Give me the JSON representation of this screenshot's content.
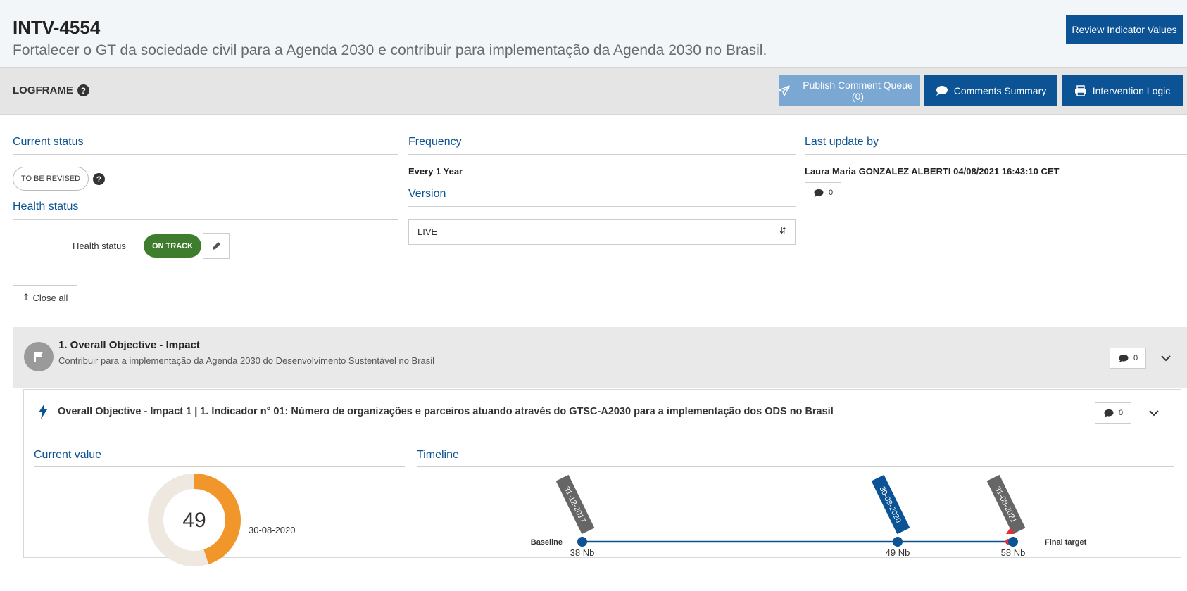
{
  "header": {
    "code": "INTV-4554",
    "subtitle": "Fortalecer o GT da sociedade civil para a Agenda 2030 e contribuir para implementação da Agenda 2030 no Brasil.",
    "review_button": "Review Indicator Values"
  },
  "logframe": {
    "title": "LOGFRAME",
    "publish_button": "Publish Comment Queue (0)",
    "comments_summary_button": "Comments Summary",
    "intervention_logic_button": "Intervention Logic"
  },
  "status": {
    "current_status_label": "Current status",
    "current_status_value": "TO BE REVISED",
    "health_status_heading": "Health status",
    "health_status_label": "Health status",
    "health_status_value": "ON TRACK"
  },
  "frequency": {
    "label": "Frequency",
    "value": "Every 1 Year",
    "version_label": "Version",
    "version_selected": "LIVE"
  },
  "last_update": {
    "label": "Last update by",
    "value": "Laura Maria GONZALEZ ALBERTI 04/08/2021 16:43:10 CET",
    "comment_count": "0"
  },
  "close_all_button": "Close all",
  "objective": {
    "title": "1. Overall Objective - Impact",
    "description": "Contribuir para a implementação da Agenda 2030 do Desenvolvimento Sustentável no Brasil",
    "comment_count": "0"
  },
  "indicator": {
    "title": "Overall Objective - Impact 1 | 1. Indicador n° 01: Número de organizações e parceiros atuando através do GTSC-A2030 para a implementação dos ODS no Brasil",
    "comment_count": "0",
    "current_value_label": "Current value",
    "current_value": "49",
    "current_value_date": "30-08-2020",
    "progress_fraction": 0.45,
    "timeline_label": "Timeline",
    "baseline_label": "Baseline",
    "final_target_label": "Final target",
    "timeline": [
      {
        "date": "31-12-2017",
        "value": "38 Nb",
        "type": "baseline"
      },
      {
        "date": "30-08-2020",
        "value": "49 Nb",
        "type": "current"
      },
      {
        "date": "31-08-2021",
        "value": "58 Nb",
        "type": "target"
      }
    ]
  },
  "colors": {
    "primary": "#0b5394",
    "publish_disabled": "#7ba8d3",
    "on_track": "#3e7d2e",
    "donut_fill": "#f0962a",
    "donut_track": "#efe8e0",
    "date_tag_gray": "#666666",
    "target_marker": "#e0303a"
  },
  "icons": {
    "help": "question-circle-icon",
    "send": "paper-plane-icon",
    "comment": "comment-icon",
    "print": "print-icon",
    "edit": "pencil-icon",
    "flag": "flag-icon",
    "bolt": "bolt-icon",
    "chevron": "chevron-down-icon",
    "close_all": "arrow-up-icon"
  }
}
